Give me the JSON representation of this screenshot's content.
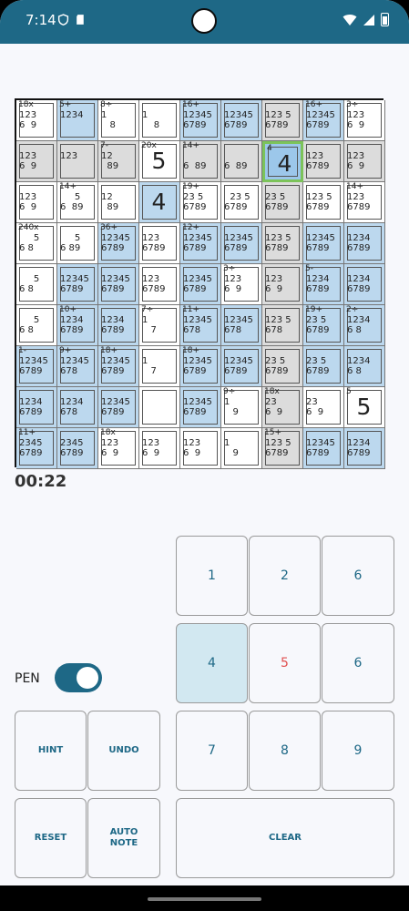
{
  "status": {
    "time": "7:14"
  },
  "timer": "00:22",
  "pen": {
    "label": "PEN",
    "on": true
  },
  "keys": {
    "n1": "1",
    "n2": "2",
    "n3": "6",
    "n4": "4",
    "n5": "5",
    "n6": "6",
    "n7": "7",
    "n8": "8",
    "n9": "9",
    "hint": "HINT",
    "undo": "UNDO",
    "reset": "RESET",
    "auto_note": "AUTO NOTE",
    "clear": "CLEAR"
  },
  "grid": {
    "r0": [
      {
        "cage": "18x",
        "notes": "123\n6  9",
        "bg": "w"
      },
      {
        "cage": "5+",
        "notes": "1234",
        "bg": "b"
      },
      {
        "cage": "8÷",
        "notes": "1\n   8",
        "bg": "w"
      },
      {
        "cage": "",
        "notes": "1\n    8",
        "bg": "w"
      },
      {
        "cage": "16+",
        "notes": "12345\n6789",
        "bg": "b"
      },
      {
        "cage": "",
        "notes": "12345\n6789",
        "bg": "b"
      },
      {
        "cage": "",
        "notes": "123 5\n6789",
        "bg": "g"
      },
      {
        "cage": "16+",
        "notes": "12345\n6789",
        "bg": "b"
      },
      {
        "cage": "3÷",
        "notes": "123\n6  9",
        "bg": "w"
      }
    ],
    "r1": [
      {
        "cage": "",
        "notes": "123\n6  9",
        "bg": "g"
      },
      {
        "cage": "",
        "notes": "123",
        "bg": "g"
      },
      {
        "cage": "7-",
        "notes": "12\n  89",
        "bg": "g"
      },
      {
        "cage": "20x",
        "notes": "",
        "bg": "w",
        "value": "5"
      },
      {
        "cage": "14+",
        "notes": "\n6  89",
        "bg": "g"
      },
      {
        "cage": "",
        "notes": "\n6  89",
        "bg": "g"
      },
      {
        "cage": "4",
        "notes": "",
        "bg": "sel",
        "value": "4"
      },
      {
        "cage": "",
        "notes": "123\n6789",
        "bg": "g"
      },
      {
        "cage": "",
        "notes": "123\n6  9",
        "bg": "g"
      }
    ],
    "r2": [
      {
        "cage": "",
        "notes": "123\n6  9",
        "bg": "w"
      },
      {
        "cage": "14+",
        "notes": "     5\n6  89",
        "bg": "w"
      },
      {
        "cage": "",
        "notes": "12\n  89",
        "bg": "w"
      },
      {
        "cage": "",
        "notes": "",
        "bg": "b",
        "value": "4"
      },
      {
        "cage": "19+",
        "notes": "23 5\n6789",
        "bg": "w"
      },
      {
        "cage": "",
        "notes": "  23 5\n6789",
        "bg": "w"
      },
      {
        "cage": "",
        "notes": "23 5\n6789",
        "bg": "g"
      },
      {
        "cage": "",
        "notes": "123 5\n6789",
        "bg": "w"
      },
      {
        "cage": "14+",
        "notes": "123\n6789",
        "bg": "w"
      }
    ],
    "r3": [
      {
        "cage": "240x",
        "notes": "     5\n6 8",
        "bg": "w"
      },
      {
        "cage": "",
        "notes": "     5\n6 89",
        "bg": "w"
      },
      {
        "cage": "36+",
        "notes": "12345\n6789",
        "bg": "b"
      },
      {
        "cage": "",
        "notes": "123\n6789",
        "bg": "w"
      },
      {
        "cage": "12+",
        "notes": "12345\n6789",
        "bg": "b"
      },
      {
        "cage": "",
        "notes": "12345\n6789",
        "bg": "b"
      },
      {
        "cage": "",
        "notes": "123 5\n6789",
        "bg": "g"
      },
      {
        "cage": "",
        "notes": "12345\n6789",
        "bg": "b"
      },
      {
        "cage": "",
        "notes": "1234\n6789",
        "bg": "b"
      }
    ],
    "r4": [
      {
        "cage": "",
        "notes": "     5\n6 8",
        "bg": "w"
      },
      {
        "cage": "",
        "notes": "12345\n6789",
        "bg": "b"
      },
      {
        "cage": "",
        "notes": "12345\n6789",
        "bg": "b"
      },
      {
        "cage": "",
        "notes": "123\n6789",
        "bg": "w"
      },
      {
        "cage": "",
        "notes": "12345\n6789",
        "bg": "b"
      },
      {
        "cage": "3÷",
        "notes": "123\n6  9",
        "bg": "w"
      },
      {
        "cage": "",
        "notes": "123\n6  9",
        "bg": "g"
      },
      {
        "cage": "5-",
        "notes": "1234\n6789",
        "bg": "b"
      },
      {
        "cage": "",
        "notes": "1234\n6789",
        "bg": "b"
      }
    ],
    "r5": [
      {
        "cage": "",
        "notes": "     5\n6 8",
        "bg": "w"
      },
      {
        "cage": "10+",
        "notes": "1234\n6789",
        "bg": "b"
      },
      {
        "cage": "",
        "notes": "1234\n6789",
        "bg": "b"
      },
      {
        "cage": "7÷",
        "notes": "1\n   7",
        "bg": "w"
      },
      {
        "cage": "11+",
        "notes": "12345\n678",
        "bg": "b"
      },
      {
        "cage": "",
        "notes": "12345\n678",
        "bg": "b"
      },
      {
        "cage": "",
        "notes": "123 5\n678",
        "bg": "g"
      },
      {
        "cage": "19+",
        "notes": "23 5\n6789",
        "bg": "b"
      },
      {
        "cage": "2÷",
        "notes": "1234\n6 8",
        "bg": "b"
      }
    ],
    "r6": [
      {
        "cage": "1-",
        "notes": "12345\n6789",
        "bg": "b"
      },
      {
        "cage": "9+",
        "notes": "12345\n678",
        "bg": "b"
      },
      {
        "cage": "18+",
        "notes": "12345\n6789",
        "bg": "b"
      },
      {
        "cage": "",
        "notes": "1\n   7",
        "bg": "w"
      },
      {
        "cage": "18+",
        "notes": "12345\n6789",
        "bg": "b"
      },
      {
        "cage": "",
        "notes": "12345\n6789",
        "bg": "b"
      },
      {
        "cage": "",
        "notes": "23 5\n6789",
        "bg": "g"
      },
      {
        "cage": "",
        "notes": "23 5\n6789",
        "bg": "b"
      },
      {
        "cage": "",
        "notes": "1234\n6 8",
        "bg": "b"
      }
    ],
    "r7": [
      {
        "cage": "",
        "notes": "1234\n6789",
        "bg": "b"
      },
      {
        "cage": "",
        "notes": "1234\n678",
        "bg": "b"
      },
      {
        "cage": "",
        "notes": "12345\n6789",
        "bg": "b"
      },
      {
        "cage": "",
        "notes": "",
        "bg": "w"
      },
      {
        "cage": "",
        "notes": "12345\n6789",
        "bg": "b"
      },
      {
        "cage": "9÷",
        "notes": "1\n   9",
        "bg": "w"
      },
      {
        "cage": "18x",
        "notes": "23\n6  9",
        "bg": "g"
      },
      {
        "cage": "",
        "notes": "23\n6  9",
        "bg": "w"
      },
      {
        "cage": "5",
        "notes": "",
        "bg": "w",
        "value": "5"
      }
    ],
    "r8": [
      {
        "cage": "11+",
        "notes": "2345\n6789",
        "bg": "b"
      },
      {
        "cage": "",
        "notes": "2345\n6789",
        "bg": "b"
      },
      {
        "cage": "18x",
        "notes": "123\n6  9",
        "bg": "w"
      },
      {
        "cage": "",
        "notes": "123\n6  9",
        "bg": "w"
      },
      {
        "cage": "",
        "notes": "123\n6  9",
        "bg": "w"
      },
      {
        "cage": "",
        "notes": "1\n   9",
        "bg": "w"
      },
      {
        "cage": "15+",
        "notes": "123 5\n6789",
        "bg": "g"
      },
      {
        "cage": "",
        "notes": "12345\n6789",
        "bg": "b"
      },
      {
        "cage": "",
        "notes": "1234\n6789",
        "bg": "b"
      }
    ]
  }
}
